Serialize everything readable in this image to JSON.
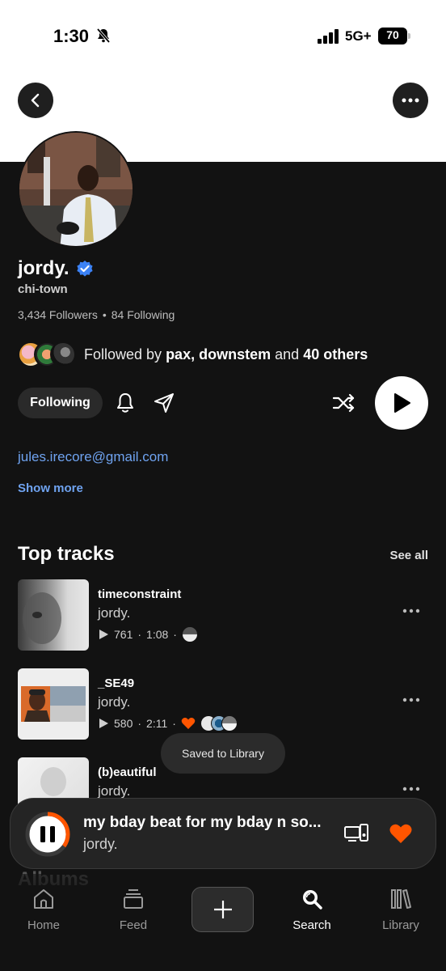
{
  "status_bar": {
    "time": "1:30",
    "network": "5G+",
    "battery": "70",
    "battery_level": 0.7
  },
  "profile": {
    "name": "jordy.",
    "location": "chi-town",
    "followers": "3,434 Followers",
    "separator": "•",
    "following_count": "84 Following",
    "followed_by_prefix": "Followed by",
    "followed_by_1": "pax,",
    "followed_by_2": "downstem",
    "followed_by_and": "and",
    "followed_by_others": "40 others",
    "following_button": "Following",
    "email": "jules.irecore@gmail.com",
    "show_more": "Show more"
  },
  "top_tracks": {
    "title": "Top tracks",
    "see_all": "See all",
    "tracks": [
      {
        "title": "timeconstraint",
        "artist": "jordy.",
        "plays": "761",
        "duration": "1:08"
      },
      {
        "title": "_SE49",
        "artist": "jordy.",
        "plays": "580",
        "duration": "2:11"
      },
      {
        "title": "(b)eautiful",
        "artist": "jordy."
      }
    ]
  },
  "toast": "Saved to Library",
  "albums_peek": "Albums",
  "mini_player": {
    "title": "my bday beat for my bday n so...",
    "artist": "jordy.",
    "progress": 0.35
  },
  "tabs": [
    {
      "label": "Home",
      "icon": "home-icon"
    },
    {
      "label": "Feed",
      "icon": "feed-icon"
    },
    {
      "label": "",
      "icon": "plus-icon"
    },
    {
      "label": "Search",
      "icon": "search-icon"
    },
    {
      "label": "Library",
      "icon": "library-icon"
    }
  ],
  "colors": {
    "accent": "#ff5500",
    "link": "#6fa3f0",
    "verified": "#3b82f6",
    "background": "#121212"
  }
}
